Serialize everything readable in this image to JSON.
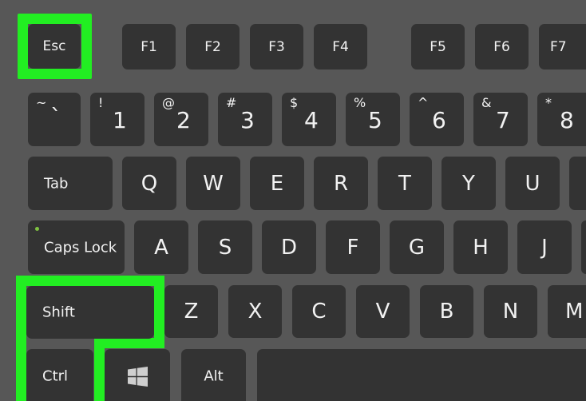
{
  "highlight_color": "#22ee22",
  "function_row": {
    "esc": "Esc",
    "keys": [
      "F1",
      "F2",
      "F3",
      "F4",
      "F5",
      "F6",
      "F7"
    ]
  },
  "number_row": [
    {
      "shift": "~",
      "main": "`"
    },
    {
      "shift": "!",
      "main": "1"
    },
    {
      "shift": "@",
      "main": "2"
    },
    {
      "shift": "#",
      "main": "3"
    },
    {
      "shift": "$",
      "main": "4"
    },
    {
      "shift": "%",
      "main": "5"
    },
    {
      "shift": "^",
      "main": "6"
    },
    {
      "shift": "&",
      "main": "7"
    },
    {
      "shift": "*",
      "main": "8"
    }
  ],
  "tab_row": {
    "tab": "Tab",
    "keys": [
      "Q",
      "W",
      "E",
      "R",
      "T",
      "Y",
      "U"
    ]
  },
  "caps_row": {
    "caps": "Caps Lock",
    "keys": [
      "A",
      "S",
      "D",
      "F",
      "G",
      "H",
      "J"
    ]
  },
  "shift_row": {
    "shift": "Shift",
    "keys": [
      "Z",
      "X",
      "C",
      "V",
      "B",
      "N",
      "M"
    ]
  },
  "bottom_row": {
    "ctrl": "Ctrl",
    "win_icon": "windows-logo-icon",
    "alt": "Alt"
  },
  "highlighted_keys": [
    "Esc",
    "Shift",
    "Ctrl"
  ]
}
